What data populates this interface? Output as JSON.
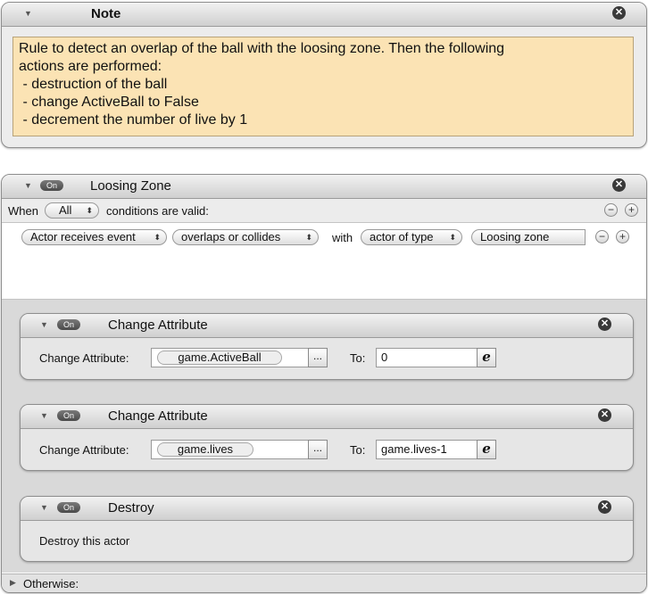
{
  "note": {
    "title": "Note",
    "lines": [
      "Rule to detect an overlap of the ball with the loosing zone. Then the following",
      "actions are performed:",
      " - destruction of the ball",
      " - change ActiveBall to False",
      " - decrement the number of live by 1"
    ]
  },
  "rule": {
    "on_label": "On",
    "title": "Loosing Zone",
    "when_label": "When",
    "when_value": "All",
    "conditions_text": "conditions are valid:",
    "condition": {
      "event": "Actor receives event",
      "type": "overlaps or collides",
      "with_label": "with",
      "target_kind": "actor of type",
      "target": "Loosing zone"
    },
    "otherwise_label": "Otherwise:"
  },
  "actions": [
    {
      "on_label": "On",
      "title": "Change Attribute",
      "attr_label": "Change Attribute:",
      "attr_value": "game.ActiveBall",
      "dots": "...",
      "to_label": "To:",
      "to_value": "0",
      "expr_glyph": "e"
    },
    {
      "on_label": "On",
      "title": "Change Attribute",
      "attr_label": "Change Attribute:",
      "attr_value": "game.lives",
      "dots": "...",
      "to_label": "To:",
      "to_value": "game.lives-1",
      "expr_glyph": "e"
    },
    {
      "on_label": "On",
      "title": "Destroy",
      "body": "Destroy this actor"
    }
  ],
  "icons": {
    "close": "close-icon",
    "disclosure": "disclosure-triangle-icon",
    "add": "plus-icon",
    "remove": "minus-icon"
  }
}
